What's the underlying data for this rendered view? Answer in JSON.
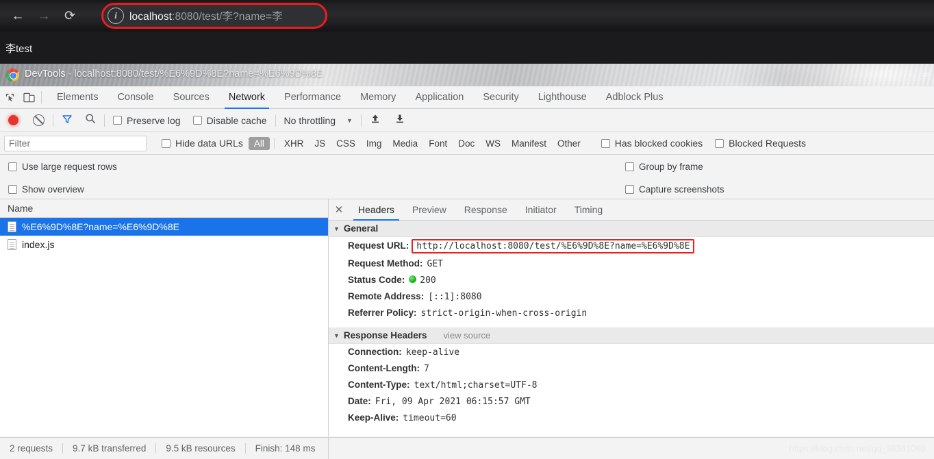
{
  "browser": {
    "nav": {
      "back": "←",
      "forward": "→",
      "reload": "⟳"
    },
    "omnibox": {
      "info_icon": "i",
      "url_host": "localhost",
      "url_rest": ":8080/test/李?name=李",
      "highlight_color": "#ee1c1c"
    },
    "page_text": "李test"
  },
  "devtools": {
    "title_prefix": "DevTools",
    "title_rest": " - localhost:8080/test/%E6%9D%8E?name=%E6%9D%8E",
    "window_controls": [
      "–",
      "▭"
    ],
    "tabs": [
      {
        "label": "Elements",
        "active": false
      },
      {
        "label": "Console",
        "active": false
      },
      {
        "label": "Sources",
        "active": false
      },
      {
        "label": "Network",
        "active": true
      },
      {
        "label": "Performance",
        "active": false
      },
      {
        "label": "Memory",
        "active": false
      },
      {
        "label": "Application",
        "active": false
      },
      {
        "label": "Security",
        "active": false
      },
      {
        "label": "Lighthouse",
        "active": false
      },
      {
        "label": "Adblock Plus",
        "active": false
      }
    ],
    "toolbar_icons": {
      "inspect": "inspect-element-icon",
      "device": "device-toolbar-icon",
      "record": "record-button",
      "clear": "clear-button",
      "funnel": "▼",
      "search": "⌕",
      "import_arrow": "⬆",
      "export_arrow": "⬇"
    },
    "toolbar": {
      "preserve_log": "Preserve log",
      "disable_cache": "Disable cache",
      "throttling": "No throttling",
      "throttling_caret": "▼"
    },
    "filter_bar": {
      "filter_placeholder": "Filter",
      "filter_value": "",
      "hide_data_urls": "Hide data URLs",
      "types": [
        "All",
        "XHR",
        "JS",
        "CSS",
        "Img",
        "Media",
        "Font",
        "Doc",
        "WS",
        "Manifest",
        "Other"
      ],
      "active_type": "All",
      "has_blocked_cookies": "Has blocked cookies",
      "blocked_requests": "Blocked Requests"
    },
    "options": {
      "use_large_request_rows": "Use large request rows",
      "show_overview": "Show overview",
      "group_by_frame": "Group by frame",
      "capture_screenshots": "Capture screenshots"
    },
    "request_list": {
      "column_header": "Name",
      "rows": [
        {
          "name": "%E6%9D%8E?name=%E6%9D%8E",
          "selected": true
        },
        {
          "name": "index.js",
          "selected": false
        }
      ]
    },
    "detail": {
      "close_icon": "✕",
      "tabs": [
        {
          "label": "Headers",
          "active": true
        },
        {
          "label": "Preview",
          "active": false
        },
        {
          "label": "Response",
          "active": false
        },
        {
          "label": "Initiator",
          "active": false
        },
        {
          "label": "Timing",
          "active": false
        }
      ],
      "general": {
        "section_title": "General",
        "caret": "▼",
        "request_url_key": "Request URL:",
        "request_url_value": "http://localhost:8080/test/%E6%9D%8E?name=%E6%9D%8E",
        "rows": [
          {
            "key": "Request Method:",
            "value": "GET"
          },
          {
            "key": "Status Code:",
            "value": "200",
            "dot": true
          },
          {
            "key": "Remote Address:",
            "value": "[::1]:8080"
          },
          {
            "key": "Referrer Policy:",
            "value": "strict-origin-when-cross-origin"
          }
        ]
      },
      "response_headers": {
        "section_title": "Response Headers",
        "caret": "▼",
        "view_source": "view source",
        "rows": [
          {
            "key": "Connection:",
            "value": "keep-alive"
          },
          {
            "key": "Content-Length:",
            "value": "7"
          },
          {
            "key": "Content-Type:",
            "value": "text/html;charset=UTF-8"
          },
          {
            "key": "Date:",
            "value": "Fri, 09 Apr 2021 06:15:57 GMT"
          },
          {
            "key": "Keep-Alive:",
            "value": "timeout=60"
          }
        ]
      }
    },
    "status_bar": {
      "requests": "2 requests",
      "transferred": "9.7 kB transferred",
      "resources": "9.5 kB resources",
      "finish": "Finish: 148 ms"
    }
  },
  "watermark": "https://blog.csdn.net/qq_36361060"
}
